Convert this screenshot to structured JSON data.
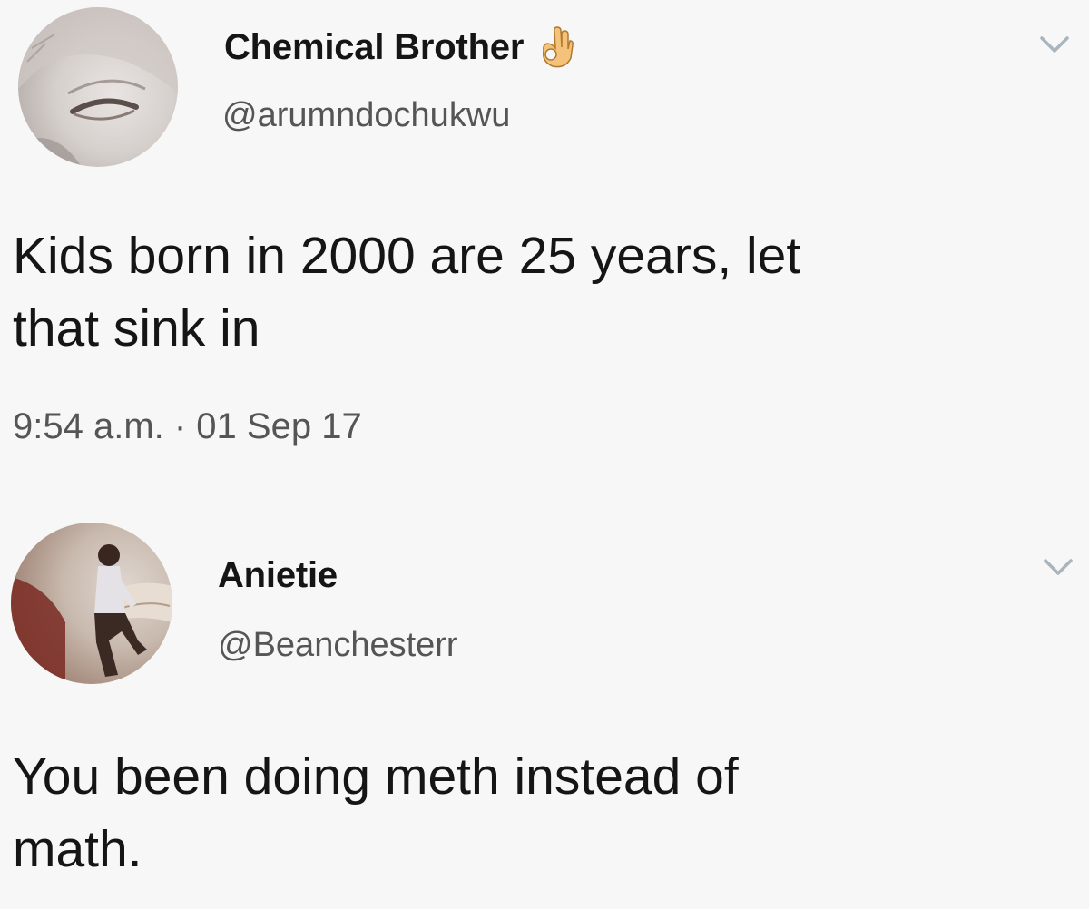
{
  "tweets": [
    {
      "display_name": "Chemical Brother",
      "name_emoji": "ok-hand-emoji",
      "handle": "@arumndochukwu",
      "text": "Kids born in 2000 are 25 years, let\nthat sink in",
      "timestamp": "9:54 a.m. · 01 Sep 17",
      "menu_icon": "chevron-down-icon"
    },
    {
      "display_name": "Anietie",
      "handle": "@Beanchesterr",
      "text": "You been doing meth instead of\nmath.",
      "menu_icon": "chevron-down-icon"
    }
  ],
  "colors": {
    "background": "#f7f7f7",
    "text": "#151515",
    "secondary_text": "#555555",
    "chevron": "#aab4bd"
  }
}
